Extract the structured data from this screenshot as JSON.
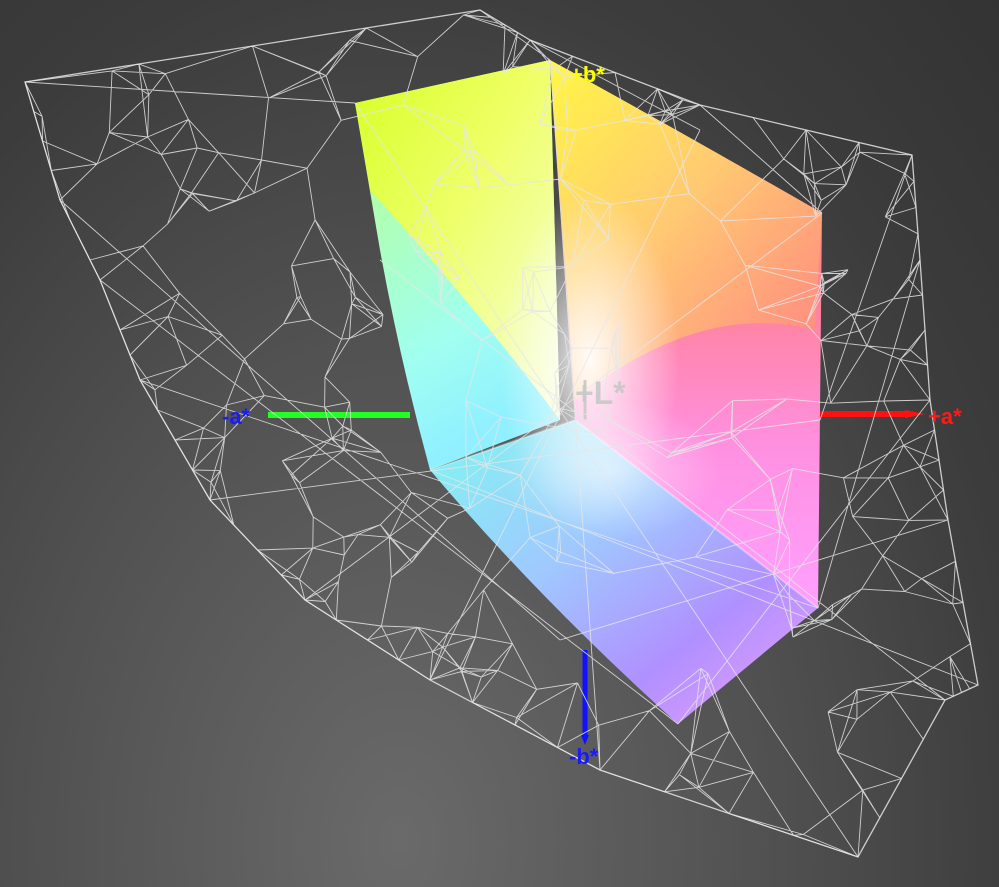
{
  "axes": {
    "plus_b": {
      "label": "+b*",
      "color": "#ffff00"
    },
    "minus_b": {
      "label": "-b*",
      "color": "#1a1aff"
    },
    "plus_a": {
      "label": "+a*",
      "color": "#ff1a1a"
    },
    "minus_a": {
      "label": "-a*",
      "color": "#1a1aff"
    },
    "plus_L": {
      "label": "+L*",
      "color": "#c8c8c8"
    }
  },
  "colors": {
    "background": "#444444",
    "wireframe": "#e6e6e6",
    "minus_a_axis_line": "#22ff22",
    "plus_a_axis_line": "#ff1111",
    "minus_b_axis_line": "#1111ff"
  }
}
